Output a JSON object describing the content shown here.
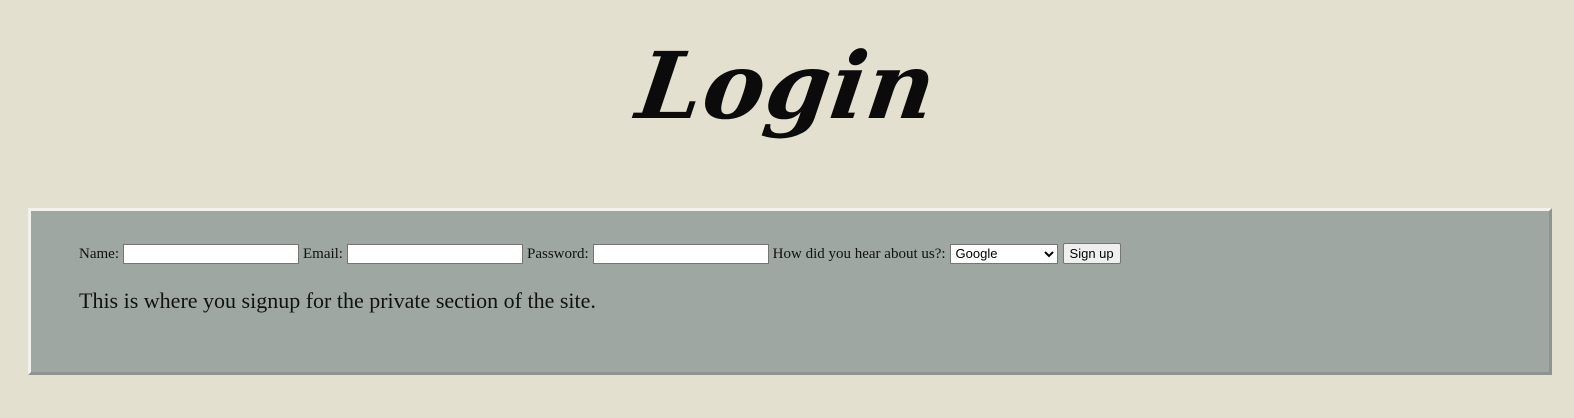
{
  "page": {
    "title": "Login"
  },
  "signup_form": {
    "name_label": "Name:",
    "email_label": "Email:",
    "password_label": "Password:",
    "referral_label": "How did you hear about us?:",
    "referral_selected": "Google",
    "submit_label": "Sign up",
    "name_value": "",
    "email_value": "",
    "password_value": ""
  },
  "description": "This is where you signup for the private section of the site.",
  "colors": {
    "background": "#e3e0d0",
    "panel": "#9ea7a2",
    "text": "#111111"
  },
  "icons": {
    "select_arrow": "chevron-down-icon"
  }
}
